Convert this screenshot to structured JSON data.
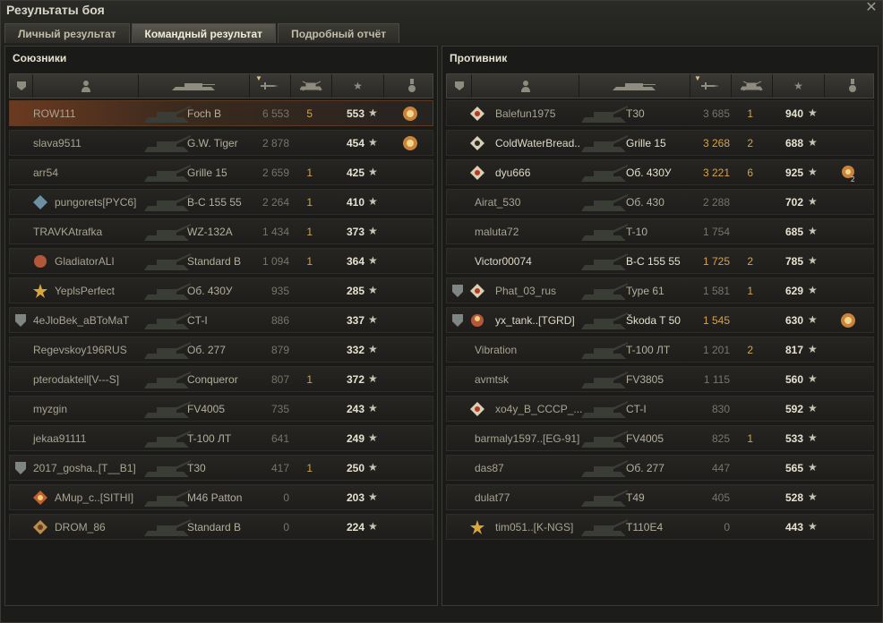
{
  "window": {
    "title": "Результаты боя",
    "close_icon": "close-icon"
  },
  "tabs": [
    {
      "label": "Личный результат",
      "active": false
    },
    {
      "label": "Командный результат",
      "active": true
    },
    {
      "label": "Подробный отчёт",
      "active": false
    }
  ],
  "allies": {
    "title": "Союзники",
    "rows": [
      {
        "player": "ROW111",
        "tank": "Foch B",
        "damage": "6 553",
        "kills": "5",
        "xp": "553",
        "medal": "medal-icon",
        "self": true,
        "clan": "",
        "badge": ""
      },
      {
        "player": "slava9511",
        "tank": "G.W. Tiger",
        "damage": "2 878",
        "kills": "",
        "xp": "454",
        "medal": "medal-icon",
        "clan": "",
        "badge": ""
      },
      {
        "player": "arr54",
        "tank": "Grille 15",
        "damage": "2 659",
        "kills": "1",
        "xp": "425",
        "clan": "",
        "badge": ""
      },
      {
        "player": "pungorets[PYC6]",
        "tank": "B-C 155 55",
        "damage": "2 264",
        "kills": "1",
        "xp": "410",
        "clan": "clan-emblem-icon",
        "badge": ""
      },
      {
        "player": "TRAVKAtrafka",
        "tank": "WZ-132A",
        "damage": "1 434",
        "kills": "1",
        "xp": "373",
        "clan": "",
        "badge": ""
      },
      {
        "player": "GladiatorALI",
        "tank": "Standard B",
        "damage": "1 094",
        "kills": "1",
        "xp": "364",
        "clan": "clan-emblem-icon",
        "badge": ""
      },
      {
        "player": "YeplsPerfect",
        "tank": "Об. 430У",
        "damage": "935",
        "kills": "",
        "xp": "285",
        "clan": "clan-emblem-icon",
        "badge": ""
      },
      {
        "player": "4eJloBek_aBToMaT",
        "tank": "CT-I",
        "damage": "886",
        "kills": "",
        "xp": "337",
        "clan": "",
        "badge": "shield-badge-icon"
      },
      {
        "player": "Regevskoy196RUS",
        "tank": "Об. 277",
        "damage": "879",
        "kills": "",
        "xp": "332",
        "clan": "",
        "badge": ""
      },
      {
        "player": "pterodaktell[V---S]",
        "tank": "Conqueror",
        "damage": "807",
        "kills": "1",
        "xp": "372",
        "clan": "",
        "badge": ""
      },
      {
        "player": "myzgin",
        "tank": "FV4005",
        "damage": "735",
        "kills": "",
        "xp": "243",
        "clan": "",
        "badge": ""
      },
      {
        "player": "jekaa91111",
        "tank": "T-100 ЛТ",
        "damage": "641",
        "kills": "",
        "xp": "249",
        "clan": "",
        "badge": ""
      },
      {
        "player": "2017_gosha..[T__B1]",
        "tank": "T30",
        "damage": "417",
        "kills": "1",
        "xp": "250",
        "clan": "",
        "badge": "shield-badge-icon"
      },
      {
        "player": "AMup_c..[SITHI]",
        "tank": "M46 Patton",
        "damage": "0",
        "kills": "",
        "xp": "203",
        "clan": "clan-emblem-icon",
        "badge": ""
      },
      {
        "player": "DROM_86",
        "tank": "Standard B",
        "damage": "0",
        "kills": "",
        "xp": "224",
        "clan": "clan-emblem-icon",
        "badge": ""
      }
    ]
  },
  "enemies": {
    "title": "Противник",
    "rows": [
      {
        "player": "Balefun1975",
        "tank": "T30",
        "damage": "3 685",
        "kills": "1",
        "xp": "940",
        "clan": "clan-emblem-icon",
        "badge": ""
      },
      {
        "player": "ColdWaterBread..",
        "tank": "Grille 15",
        "damage": "3 268",
        "kills": "2",
        "xp": "688",
        "clan": "clan-emblem-icon",
        "badge": "",
        "alive": true
      },
      {
        "player": "dyu666",
        "tank": "Об. 430У",
        "damage": "3 221",
        "kills": "6",
        "xp": "925",
        "clan": "clan-emblem-icon",
        "badge": "",
        "alive": true,
        "medal": "medal-icon",
        "medal_count": "2"
      },
      {
        "player": "Airat_530",
        "tank": "Об. 430",
        "damage": "2 288",
        "kills": "",
        "xp": "702",
        "clan": "",
        "badge": ""
      },
      {
        "player": "maluta72",
        "tank": "T-10",
        "damage": "1 754",
        "kills": "",
        "xp": "685",
        "clan": "",
        "badge": ""
      },
      {
        "player": "Victor00074",
        "tank": "B-C 155 55",
        "damage": "1 725",
        "kills": "2",
        "xp": "785",
        "clan": "",
        "badge": "",
        "alive": true
      },
      {
        "player": "Phat_03_rus",
        "tank": "Type 61",
        "damage": "1 581",
        "kills": "1",
        "xp": "629",
        "clan": "clan-emblem-icon",
        "badge": "shield-badge-icon"
      },
      {
        "player": "yx_tank..[TGRD]",
        "tank": "Škoda T 50",
        "damage": "1 545",
        "kills": "",
        "xp": "630",
        "clan": "clan-emblem-icon",
        "badge": "shield-badge-icon",
        "alive": true,
        "medal": "medal-icon"
      },
      {
        "player": "Vibration",
        "tank": "T-100 ЛТ",
        "damage": "1 201",
        "kills": "2",
        "xp": "817",
        "clan": "",
        "badge": ""
      },
      {
        "player": "avmtsk",
        "tank": "FV3805",
        "damage": "1 115",
        "kills": "",
        "xp": "560",
        "clan": "",
        "badge": ""
      },
      {
        "player": "xo4y_B_CCCP_...",
        "tank": "CT-I",
        "damage": "830",
        "kills": "",
        "xp": "592",
        "clan": "clan-emblem-icon",
        "badge": ""
      },
      {
        "player": "barmaly1597..[EG-91]",
        "tank": "FV4005",
        "damage": "825",
        "kills": "1",
        "xp": "533",
        "clan": "",
        "badge": ""
      },
      {
        "player": "das87",
        "tank": "Об. 277",
        "damage": "447",
        "kills": "",
        "xp": "565",
        "clan": "",
        "badge": ""
      },
      {
        "player": "dulat77",
        "tank": "T49",
        "damage": "405",
        "kills": "",
        "xp": "528",
        "clan": "",
        "badge": ""
      },
      {
        "player": "tim051..[K-NGS]",
        "tank": "T110E4",
        "damage": "0",
        "kills": "",
        "xp": "443",
        "clan": "clan-emblem-icon",
        "badge": ""
      }
    ]
  },
  "colors": {
    "accent": "#d6a24a",
    "self_row": "#6b3a20"
  }
}
